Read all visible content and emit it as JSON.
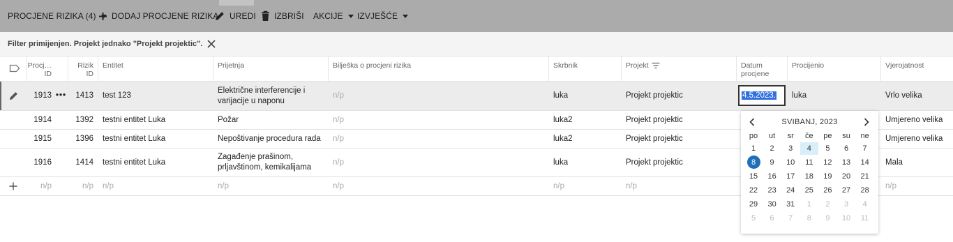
{
  "toolbar": {
    "items": [
      {
        "label": "PROCJENE RIZIKA (4)",
        "icon": "caret-down-icon"
      },
      {
        "label": "DODAJ PROCJENE RIZIKA",
        "icon": "plus-icon"
      },
      {
        "label": "UREDI",
        "icon": "pencil-icon"
      },
      {
        "label": "IZBRIŠI",
        "icon": "trash-icon"
      },
      {
        "label": "AKCIJE",
        "icon": "caret-down-icon"
      },
      {
        "label": "IZVJEŠĆE",
        "icon": "caret-down-icon"
      }
    ]
  },
  "filter": {
    "text": "Filter primijenjen. Projekt jednako \"Projekt projektic\".",
    "clear_icon": "close-icon"
  },
  "columns": {
    "procjena_id": [
      "Procj…",
      "ID"
    ],
    "rizik_id": [
      "Rizik",
      "ID"
    ],
    "entitet": "Entitet",
    "prijetnja": "Prijetnja",
    "biljeska": "Bilješka o procjeni rizika",
    "skrbnik": "Skrbnik",
    "projekt": "Projekt",
    "datum": [
      "Datum",
      "procjene"
    ],
    "procijenio": "Procijenio",
    "vjerojatnost": "Vjerojatnost"
  },
  "rows": [
    {
      "procjena_id": "1913",
      "more": "•••",
      "rizik_id": "1413",
      "entitet": "test 123",
      "prijetnja": [
        "Električne interferencije i",
        "varijacije u naponu"
      ],
      "biljeska": "n/p",
      "skrbnik": "luka",
      "projekt": "Projekt projektic",
      "datum": "4.5.2023.",
      "procijenio": "luka",
      "vjerojatnost": "Vrlo velika"
    },
    {
      "procjena_id": "1914",
      "rizik_id": "1392",
      "entitet": "testni entitet Luka",
      "prijetnja": [
        "Požar"
      ],
      "biljeska": "n/p",
      "skrbnik": "luka2",
      "projekt": "Projekt projektic",
      "vjerojatnost": "Umjereno velika"
    },
    {
      "procjena_id": "1915",
      "rizik_id": "1396",
      "entitet": "testni entitet Luka",
      "prijetnja": [
        "Nepoštivanje procedura rada"
      ],
      "biljeska": "n/p",
      "skrbnik": "luka2",
      "projekt": "Projekt projektic",
      "vjerojatnost": "Umjereno velika"
    },
    {
      "procjena_id": "1916",
      "rizik_id": "1414",
      "entitet": "testni entitet Luka",
      "prijetnja": [
        "Zagađenje prašinom,",
        "prljavštinom, kemikalijama"
      ],
      "biljeska": "n/p",
      "skrbnik": "luka",
      "projekt": "Projekt projektic",
      "vjerojatnost": "Mala"
    }
  ],
  "new_row": {
    "procjena_id": "n/p",
    "rizik_id": "n/p",
    "entitet": "n/p",
    "prijetnja": "n/p",
    "biljeska": "n/p",
    "skrbnik": "n/p",
    "projekt": "n/p",
    "vjerojatnost": "n/p"
  },
  "datepicker": {
    "title": "SVIBANJ, 2023",
    "weekdays": [
      "po",
      "ut",
      "sr",
      "če",
      "pe",
      "su",
      "ne"
    ],
    "weeks": [
      [
        "1",
        "2",
        "3",
        "4",
        "5",
        "6",
        "7"
      ],
      [
        "8",
        "9",
        "10",
        "11",
        "12",
        "13",
        "14"
      ],
      [
        "15",
        "16",
        "17",
        "18",
        "19",
        "20",
        "21"
      ],
      [
        "22",
        "23",
        "24",
        "25",
        "26",
        "27",
        "28"
      ],
      [
        "29",
        "30",
        "31",
        "1",
        "2",
        "3",
        "4"
      ],
      [
        "5",
        "6",
        "7",
        "8",
        "9",
        "10",
        "11"
      ]
    ],
    "selected_day": "8",
    "highlighted_day": "4"
  },
  "colors": {
    "toolbar_bg": "#ababab",
    "selected_day": "#1f6fb8",
    "today_bg": "#d8eefb",
    "input_selection": "#2f6fdf"
  }
}
